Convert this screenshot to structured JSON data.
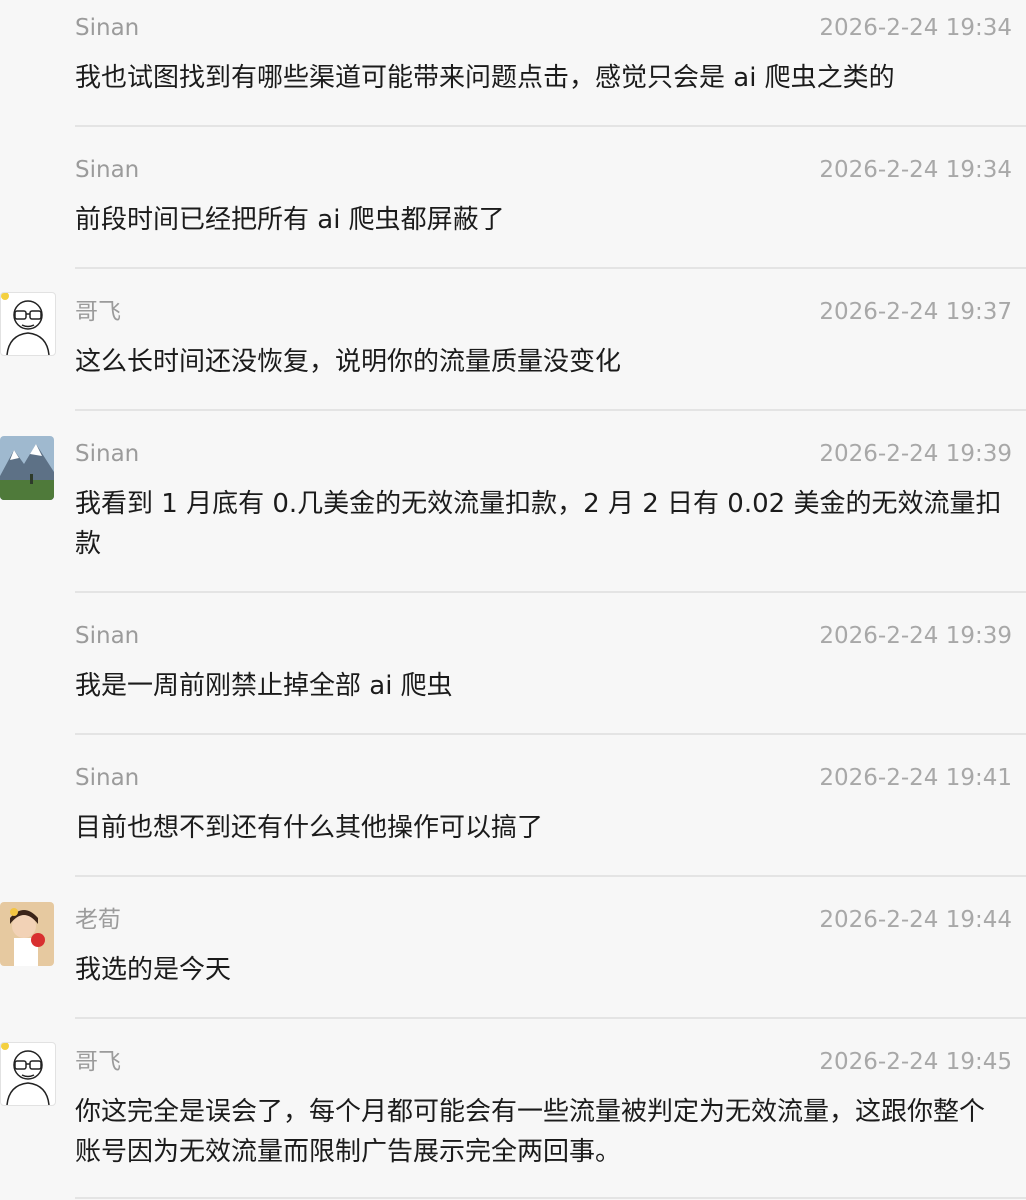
{
  "messages": [
    {
      "sender": "Sinan",
      "time": "2026-2-24 19:34",
      "text": "我也试图找到有哪些渠道可能带来问题点击，感觉只会是 ai 爬虫之类的",
      "avatar": "none"
    },
    {
      "sender": "Sinan",
      "time": "2026-2-24 19:34",
      "text": "前段时间已经把所有 ai 爬虫都屏蔽了",
      "avatar": "none"
    },
    {
      "sender": "哥飞",
      "time": "2026-2-24 19:37",
      "text": "这么长时间还没恢复，说明你的流量质量没变化",
      "avatar": "cartoon-man-icon"
    },
    {
      "sender": "Sinan",
      "time": "2026-2-24 19:39",
      "text": "我看到 1 月底有 0.几美金的无效流量扣款，2 月 2 日有 0.02 美金的无效流量扣款",
      "avatar": "mountain-photo"
    },
    {
      "sender": "Sinan",
      "time": "2026-2-24 19:39",
      "text": "我是一周前刚禁止掉全部 ai 爬虫",
      "avatar": "none"
    },
    {
      "sender": "Sinan",
      "time": "2026-2-24 19:41",
      "text": "目前也想不到还有什么其他操作可以搞了",
      "avatar": "none"
    },
    {
      "sender": "老荀",
      "time": "2026-2-24 19:44",
      "text": "我选的是今天",
      "avatar": "child-photo"
    },
    {
      "sender": "哥飞",
      "time": "2026-2-24 19:45",
      "text": "你这完全是误会了，每个月都可能会有一些流量被判定为无效流量，这跟你整个账号因为无效流量而限制广告展示完全两回事。",
      "avatar": "cartoon-man-icon"
    }
  ]
}
